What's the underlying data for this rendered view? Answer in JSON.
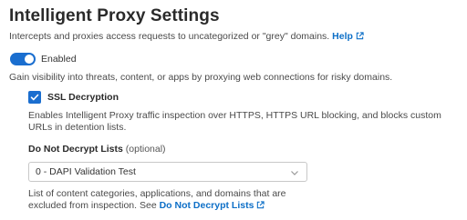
{
  "header": {
    "title": "Intelligent Proxy Settings",
    "subtitle": "Intercepts and proxies access requests to uncategorized or \"grey\" domains.",
    "help_link": "Help"
  },
  "proxy_toggle": {
    "state": true,
    "label": "Enabled"
  },
  "proxy_description": "Gain visibility into threats, content, or apps by proxying web connections for risky domains.",
  "ssl": {
    "checked": true,
    "label": "SSL Decryption",
    "description": "Enables Intelligent Proxy traffic inspection over HTTPS, HTTPS URL blocking, and blocks custom URLs in detention lists."
  },
  "do_not_decrypt": {
    "label": "Do Not Decrypt Lists",
    "optional": "(optional)",
    "selected": "0 - DAPI Validation Test",
    "help_text": "List of content categories, applications, and domains that are excluded from inspection. See",
    "help_link": "Do Not Decrypt Lists"
  },
  "colors": {
    "accent": "#1a6ecf",
    "link": "#0d6fc7"
  },
  "icons": {
    "external_link": "external-link-icon",
    "checkmark": "checkmark-icon",
    "chevron": "chevron-down-icon"
  }
}
